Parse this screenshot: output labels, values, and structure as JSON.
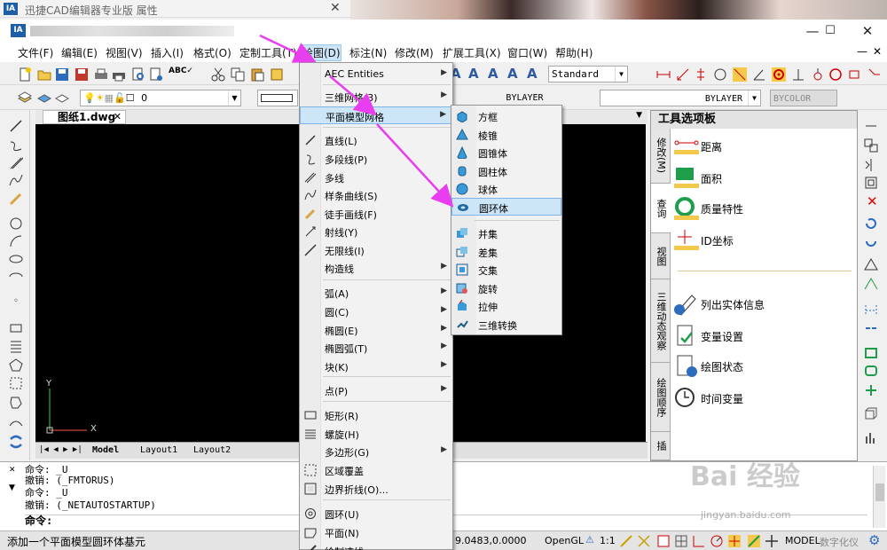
{
  "bg_window": {
    "title": "迅捷CAD编辑器专业版 属性",
    "close": "✕"
  },
  "app": {
    "title_blurred": "",
    "min": "—",
    "max": "☐",
    "close": "✕"
  },
  "menubar": [
    {
      "label": "文件(F)"
    },
    {
      "label": "编辑(E)"
    },
    {
      "label": "视图(V)"
    },
    {
      "label": "插入(I)"
    },
    {
      "label": "格式(O)"
    },
    {
      "label": "定制工具(T)"
    },
    {
      "label": "绘图(D)"
    },
    {
      "label": "标注(N)"
    },
    {
      "label": "修改(M)"
    },
    {
      "label": "扩展工具(X)"
    },
    {
      "label": "窗口(W)"
    },
    {
      "label": "帮助(H)"
    }
  ],
  "toolbar": {
    "text_style": "Standard",
    "layer_value": "0",
    "linetype": "BYLAYER",
    "lineweight": "BYLAYER",
    "color": "BYCOLOR"
  },
  "document": {
    "tab": "图纸1.dwg",
    "tab_close": "✕",
    "axis_x": "X",
    "axis_y": "Y"
  },
  "layouts": {
    "model": "Model",
    "layout1": "Layout1",
    "layout2": "Layout2"
  },
  "draw_menu": [
    {
      "label": "AEC Entities",
      "sub": "▶",
      "icon": "blank-icon"
    },
    {
      "label": "三维网格(3)",
      "sub": "▶",
      "icon": "blank-icon"
    },
    {
      "label": "平面模型网格",
      "sub": "▶",
      "icon": "blank-icon"
    },
    {
      "label": "直线(L)",
      "sub": "",
      "icon": "line-icon"
    },
    {
      "label": "多段线(P)",
      "sub": "",
      "icon": "polyline-icon"
    },
    {
      "label": "多线",
      "sub": "",
      "icon": "multiline-icon"
    },
    {
      "label": "样条曲线(S)",
      "sub": "",
      "icon": "spline-icon"
    },
    {
      "label": "徒手画线(F)",
      "sub": "",
      "icon": "freehand-icon"
    },
    {
      "label": "射线(Y)",
      "sub": "",
      "icon": "ray-icon"
    },
    {
      "label": "无限线(I)",
      "sub": "",
      "icon": "xline-icon"
    },
    {
      "label": "构造线",
      "sub": "▶",
      "icon": "blank-icon"
    },
    {
      "label": "弧(A)",
      "sub": "▶",
      "icon": "blank-icon"
    },
    {
      "label": "圆(C)",
      "sub": "▶",
      "icon": "blank-icon"
    },
    {
      "label": "椭圆(E)",
      "sub": "▶",
      "icon": "blank-icon"
    },
    {
      "label": "椭圆弧(T)",
      "sub": "▶",
      "icon": "blank-icon"
    },
    {
      "label": "块(K)",
      "sub": "▶",
      "icon": "blank-icon"
    },
    {
      "label": "点(P)",
      "sub": "▶",
      "icon": "blank-icon"
    },
    {
      "label": "矩形(R)",
      "sub": "",
      "icon": "rectangle-icon"
    },
    {
      "label": "螺旋(H)",
      "sub": "",
      "icon": "helix-icon"
    },
    {
      "label": "多边形(G)",
      "sub": "▶",
      "icon": "blank-icon"
    },
    {
      "label": "区域覆盖",
      "sub": "",
      "icon": "wipeout-icon"
    },
    {
      "label": "边界折线(O)...",
      "sub": "",
      "icon": "boundary-icon"
    },
    {
      "label": "圆环(U)",
      "sub": "",
      "icon": "donut-icon"
    },
    {
      "label": "平面(N)",
      "sub": "",
      "icon": "plane-icon"
    },
    {
      "label": "绘制迹线",
      "sub": "",
      "icon": "trace-icon"
    }
  ],
  "mesh_menu": [
    {
      "label": "方框",
      "icon": "box-icon"
    },
    {
      "label": "棱锥",
      "icon": "pyramid-icon"
    },
    {
      "label": "圆锥体",
      "icon": "cone-icon"
    },
    {
      "label": "圆柱体",
      "icon": "cylinder-icon"
    },
    {
      "label": "球体",
      "icon": "sphere-icon"
    },
    {
      "label": "圆环体",
      "icon": "torus-icon"
    },
    {
      "label": "并集",
      "icon": "union-icon"
    },
    {
      "label": "差集",
      "icon": "subtract-icon"
    },
    {
      "label": "交集",
      "icon": "intersect-icon"
    },
    {
      "label": "旋转",
      "icon": "revolve-icon"
    },
    {
      "label": "拉伸",
      "icon": "extrude-icon"
    },
    {
      "label": "三维转换",
      "icon": "convert3d-icon"
    }
  ],
  "palette": {
    "title": "工具选项板",
    "tabs": [
      "修改(M)",
      "查询",
      "视图",
      "三维动态观察",
      "绘图顺序",
      "插"
    ],
    "items": [
      {
        "label": "距离",
        "icon": "distance-icon"
      },
      {
        "label": "面积",
        "icon": "area-icon"
      },
      {
        "label": "质量特性",
        "icon": "massprop-icon"
      },
      {
        "label": "ID坐标",
        "icon": "idpoint-icon"
      },
      {
        "label": "列出实体信息",
        "icon": "list-icon"
      },
      {
        "label": "变量设置",
        "icon": "setvar-icon"
      },
      {
        "label": "绘图状态",
        "icon": "status-icon"
      },
      {
        "label": "时间变量",
        "icon": "time-icon"
      }
    ]
  },
  "command": {
    "lines": [
      "命令: _U",
      "撤销: (_FMTORUS)",
      "命令: _U",
      "撤销: (_NETAUTOSTARTUP)"
    ],
    "prompt": "命令:"
  },
  "status": {
    "message": "添加一个平面模型圆环体基元",
    "coords": "9.0483,0.0000",
    "opengl": "OpenGL",
    "scale": "1:1",
    "model": "MODEL",
    "digitizer": "数字化仪"
  },
  "watermark": {
    "text": "Bai 经验",
    "url": "jingyan.baidu.com"
  },
  "colors": {
    "accent": "#1e5fa8",
    "highlight": "#cde6f7",
    "arrow": "#e83ef0",
    "canvas": "#000000"
  }
}
